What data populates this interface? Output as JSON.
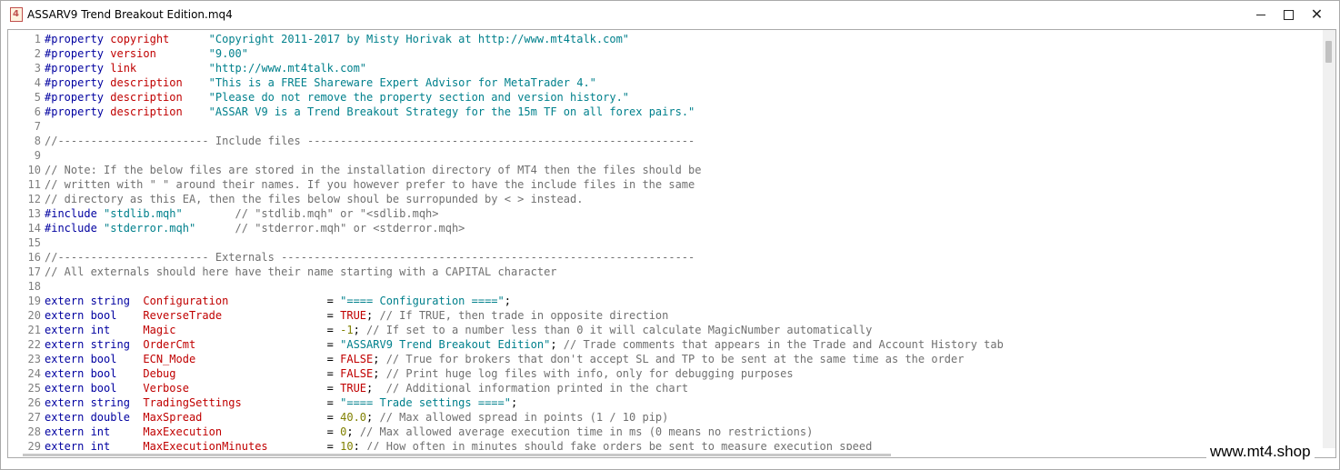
{
  "window": {
    "title": "ASSARV9 Trend Breakout Edition.mq4",
    "app_icon_glyph": "4",
    "controls": {
      "minimize": "minimize-icon",
      "maximize": "maximize-icon",
      "close": "close-icon"
    }
  },
  "colors": {
    "keyword": "#0000a0",
    "property_name": "#c00000",
    "string": "#00808c",
    "comment": "#707070",
    "number": "#808000"
  },
  "editor": {
    "lines": [
      [
        [
          "pp",
          "#property "
        ],
        [
          "pname",
          "copyright"
        ],
        [
          "op",
          "      "
        ],
        [
          "str",
          "\"Copyright 2011-2017 by Misty Horivak at http://www.mt4talk.com\""
        ]
      ],
      [
        [
          "pp",
          "#property "
        ],
        [
          "pname",
          "version"
        ],
        [
          "op",
          "        "
        ],
        [
          "str",
          "\"9.00\""
        ]
      ],
      [
        [
          "pp",
          "#property "
        ],
        [
          "pname",
          "link"
        ],
        [
          "op",
          "           "
        ],
        [
          "str",
          "\"http://www.mt4talk.com\""
        ]
      ],
      [
        [
          "pp",
          "#property "
        ],
        [
          "pname",
          "description"
        ],
        [
          "op",
          "    "
        ],
        [
          "str",
          "\"This is a FREE Shareware Expert Advisor for MetaTrader 4.\""
        ]
      ],
      [
        [
          "pp",
          "#property "
        ],
        [
          "pname",
          "description"
        ],
        [
          "op",
          "    "
        ],
        [
          "str",
          "\"Please do not remove the property section and version history.\""
        ]
      ],
      [
        [
          "pp",
          "#property "
        ],
        [
          "pname",
          "description"
        ],
        [
          "op",
          "    "
        ],
        [
          "str",
          "\"ASSAR V9 is a Trend Breakout Strategy for the 15m TF on all forex pairs.\""
        ]
      ],
      [],
      [
        [
          "cm",
          "//----------------------- Include files -----------------------------------------------------------"
        ]
      ],
      [],
      [
        [
          "cm",
          "// Note: If the below files are stored in the installation directory of MT4 then the files should be"
        ]
      ],
      [
        [
          "cm",
          "// written with \" \" around their names. If you however prefer to have the include files in the same"
        ]
      ],
      [
        [
          "cm",
          "// directory as this EA, then the files below shoul be surropunded by < > instead."
        ]
      ],
      [
        [
          "pp",
          "#include "
        ],
        [
          "str",
          "\"stdlib.mqh\""
        ],
        [
          "op",
          "        "
        ],
        [
          "cm",
          "// \"stdlib.mqh\" or \"<sdlib.mqh>"
        ]
      ],
      [
        [
          "pp",
          "#include "
        ],
        [
          "str",
          "\"stderror.mqh\""
        ],
        [
          "op",
          "      "
        ],
        [
          "cm",
          "// \"stderror.mqh\" or <stderror.mqh>"
        ]
      ],
      [],
      [
        [
          "cm",
          "//----------------------- Externals ---------------------------------------------------------------"
        ]
      ],
      [
        [
          "cm",
          "// All externals should here have their name starting with a CAPITAL character"
        ]
      ],
      [],
      [
        [
          "kw",
          "extern string  "
        ],
        [
          "vname",
          "Configuration"
        ],
        [
          "op",
          "               = "
        ],
        [
          "str",
          "\"==== Configuration ====\""
        ],
        [
          "op",
          ";"
        ]
      ],
      [
        [
          "kw",
          "extern bool    "
        ],
        [
          "vname",
          "ReverseTrade"
        ],
        [
          "op",
          "                = "
        ],
        [
          "const",
          "TRUE"
        ],
        [
          "op",
          "; "
        ],
        [
          "cm",
          "// If TRUE, then trade in opposite direction"
        ]
      ],
      [
        [
          "kw",
          "extern int     "
        ],
        [
          "vname",
          "Magic"
        ],
        [
          "op",
          "                       = "
        ],
        [
          "num",
          "-1"
        ],
        [
          "op",
          "; "
        ],
        [
          "cm",
          "// If set to a number less than 0 it will calculate MagicNumber automatically"
        ]
      ],
      [
        [
          "kw",
          "extern string  "
        ],
        [
          "vname",
          "OrderCmt"
        ],
        [
          "op",
          "                    = "
        ],
        [
          "str",
          "\"ASSARV9 Trend Breakout Edition\""
        ],
        [
          "op",
          "; "
        ],
        [
          "cm",
          "// Trade comments that appears in the Trade and Account History tab"
        ]
      ],
      [
        [
          "kw",
          "extern bool    "
        ],
        [
          "vname",
          "ECN_Mode"
        ],
        [
          "op",
          "                    = "
        ],
        [
          "const",
          "FALSE"
        ],
        [
          "op",
          "; "
        ],
        [
          "cm",
          "// True for brokers that don't accept SL and TP to be sent at the same time as the order"
        ]
      ],
      [
        [
          "kw",
          "extern bool    "
        ],
        [
          "vname",
          "Debug"
        ],
        [
          "op",
          "                       = "
        ],
        [
          "const",
          "FALSE"
        ],
        [
          "op",
          "; "
        ],
        [
          "cm",
          "// Print huge log files with info, only for debugging purposes"
        ]
      ],
      [
        [
          "kw",
          "extern bool    "
        ],
        [
          "vname",
          "Verbose"
        ],
        [
          "op",
          "                     = "
        ],
        [
          "const",
          "TRUE"
        ],
        [
          "op",
          ";  "
        ],
        [
          "cm",
          "// Additional information printed in the chart"
        ]
      ],
      [
        [
          "kw",
          "extern string  "
        ],
        [
          "vname",
          "TradingSettings"
        ],
        [
          "op",
          "             = "
        ],
        [
          "str",
          "\"==== Trade settings ====\""
        ],
        [
          "op",
          ";"
        ]
      ],
      [
        [
          "kw",
          "extern double  "
        ],
        [
          "vname",
          "MaxSpread"
        ],
        [
          "op",
          "                   = "
        ],
        [
          "num",
          "40.0"
        ],
        [
          "op",
          "; "
        ],
        [
          "cm",
          "// Max allowed spread in points (1 / 10 pip)"
        ]
      ],
      [
        [
          "kw",
          "extern int     "
        ],
        [
          "vname",
          "MaxExecution"
        ],
        [
          "op",
          "                = "
        ],
        [
          "num",
          "0"
        ],
        [
          "op",
          "; "
        ],
        [
          "cm",
          "// Max allowed average execution time in ms (0 means no restrictions)"
        ]
      ],
      [
        [
          "kw",
          "extern int     "
        ],
        [
          "vname",
          "MaxExecutionMinutes"
        ],
        [
          "op",
          "         = "
        ],
        [
          "num",
          "10"
        ],
        [
          "op",
          "; "
        ],
        [
          "cm",
          "// How often in minutes should fake orders be sent to measure execution speed"
        ]
      ]
    ]
  },
  "watermark": "www.mt4.shop"
}
